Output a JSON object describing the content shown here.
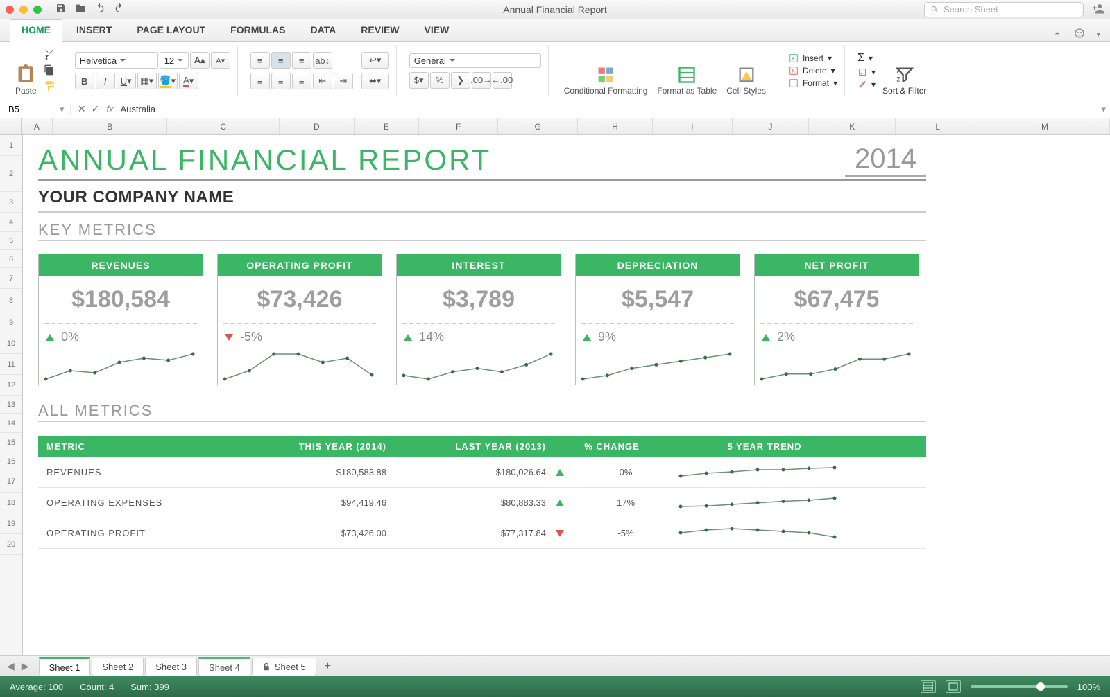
{
  "window": {
    "title": "Annual Financial Report",
    "searchPlaceholder": "Search Sheet"
  },
  "tabs": {
    "items": [
      "HOME",
      "INSERT",
      "PAGE LAYOUT",
      "FORMULAS",
      "DATA",
      "REVIEW",
      "VIEW"
    ],
    "active": 0
  },
  "ribbon": {
    "paste": "Paste",
    "font": "Helvetica",
    "size": "12",
    "numberFormat": "General",
    "cond": "Conditional Formatting",
    "fat": "Format as Table",
    "cellStyles": "Cell Styles",
    "insert": "Insert",
    "delete": "Delete",
    "format": "Format",
    "sortFilter": "Sort & Filter"
  },
  "formula": {
    "nameBox": "B5",
    "value": "Australia"
  },
  "columns": [
    "A",
    "B",
    "C",
    "D",
    "E",
    "F",
    "G",
    "H",
    "I",
    "J",
    "K",
    "L",
    "M"
  ],
  "rows": [
    "1",
    "2",
    "3",
    "4",
    "5",
    "6",
    "7",
    "8",
    "9",
    "10",
    "11",
    "12",
    "13",
    "14",
    "15",
    "16",
    "17",
    "18",
    "19",
    "20"
  ],
  "report": {
    "title": "ANNUAL FINANCIAL REPORT",
    "year": "2014",
    "subtitle": "YOUR COMPANY NAME",
    "section1": "KEY METRICS",
    "section2": "ALL METRICS",
    "cards": [
      {
        "label": "REVENUES",
        "value": "$180,584",
        "dir": "up",
        "pct": "0%"
      },
      {
        "label": "OPERATING PROFIT",
        "value": "$73,426",
        "dir": "down",
        "pct": "-5%"
      },
      {
        "label": "INTEREST",
        "value": "$3,789",
        "dir": "up",
        "pct": "14%"
      },
      {
        "label": "DEPRECIATION",
        "value": "$5,547",
        "dir": "up",
        "pct": "9%"
      },
      {
        "label": "NET PROFIT",
        "value": "$67,475",
        "dir": "up",
        "pct": "2%"
      }
    ],
    "table": {
      "headers": [
        "METRIC",
        "THIS YEAR (2014)",
        "LAST YEAR (2013)",
        "% CHANGE",
        "5 YEAR TREND"
      ],
      "rows": [
        {
          "metric": "REVENUES",
          "thisYear": "$180,583.88",
          "lastYear": "$180,026.64",
          "dir": "up",
          "pct": "0%"
        },
        {
          "metric": "OPERATING EXPENSES",
          "thisYear": "$94,419.46",
          "lastYear": "$80,883.33",
          "dir": "up",
          "pct": "17%"
        },
        {
          "metric": "OPERATING PROFIT",
          "thisYear": "$73,426.00",
          "lastYear": "$77,317.84",
          "dir": "down",
          "pct": "-5%"
        }
      ]
    }
  },
  "sheets": {
    "items": [
      "Sheet 1",
      "Sheet 2",
      "Sheet 3",
      "Sheet 4",
      "Sheet 5"
    ],
    "locked": [
      4
    ],
    "active": 0
  },
  "status": {
    "avg": "Average: 100",
    "count": "Count: 4",
    "sum": "Sum: 399",
    "zoom": "100%"
  },
  "chart_data": [
    {
      "type": "line",
      "title": "REVENUES sparkline",
      "x": [
        1,
        2,
        3,
        4,
        5,
        6,
        7
      ],
      "values": [
        170,
        174,
        173,
        178,
        180,
        179,
        182
      ]
    },
    {
      "type": "line",
      "title": "OPERATING PROFIT sparkline",
      "x": [
        1,
        2,
        3,
        4,
        5,
        6,
        7
      ],
      "values": [
        72,
        74,
        78,
        78,
        76,
        77,
        73
      ]
    },
    {
      "type": "line",
      "title": "INTEREST sparkline",
      "x": [
        1,
        2,
        3,
        4,
        5,
        6,
        7
      ],
      "values": [
        3.2,
        3.1,
        3.3,
        3.4,
        3.3,
        3.5,
        3.8
      ]
    },
    {
      "type": "line",
      "title": "DEPRECIATION sparkline",
      "x": [
        1,
        2,
        3,
        4,
        5,
        6,
        7
      ],
      "values": [
        4.8,
        4.9,
        5.1,
        5.2,
        5.3,
        5.4,
        5.5
      ]
    },
    {
      "type": "line",
      "title": "NET PROFIT sparkline",
      "x": [
        1,
        2,
        3,
        4,
        5,
        6,
        7
      ],
      "values": [
        62,
        63,
        63,
        64,
        66,
        66,
        67
      ]
    },
    {
      "type": "line",
      "title": "Revenues 5yr",
      "x": [
        1,
        2,
        3,
        4,
        5,
        6,
        7
      ],
      "values": [
        168,
        172,
        174,
        177,
        177,
        179,
        180
      ]
    },
    {
      "type": "line",
      "title": "Operating Expenses 5yr",
      "x": [
        1,
        2,
        3,
        4,
        5,
        6,
        7
      ],
      "values": [
        78,
        79,
        82,
        85,
        88,
        90,
        94
      ]
    },
    {
      "type": "line",
      "title": "Operating Profit 5yr",
      "x": [
        1,
        2,
        3,
        4,
        5,
        6,
        7
      ],
      "values": [
        76,
        78,
        79,
        78,
        77,
        76,
        73
      ]
    }
  ]
}
